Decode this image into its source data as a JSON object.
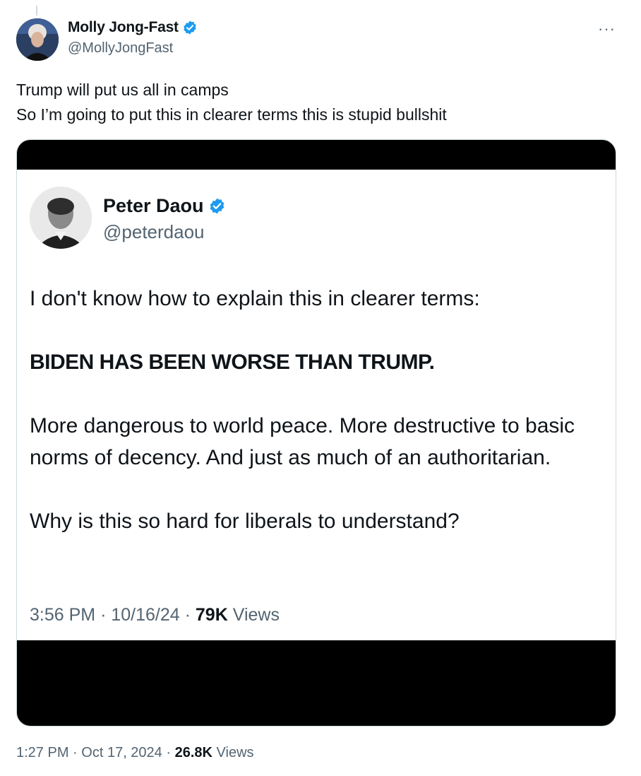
{
  "tweet": {
    "author": {
      "name": "Molly Jong-Fast",
      "handle": "@MollyJongFast",
      "verified": true
    },
    "text_lines": [
      "Trump will put us all in camps",
      "So I’m going to put this in clearer terms this is stupid bullshit"
    ],
    "more_label": "···",
    "meta": {
      "time": "1:27 PM",
      "sep1": "·",
      "date": "Oct 17, 2024",
      "sep2": "·",
      "views_count": "26.8K",
      "views_label": "Views"
    }
  },
  "quoted_screenshot": {
    "author": {
      "name": "Peter Daou",
      "handle": "@peterdaou",
      "verified": true
    },
    "paragraphs": [
      "I don't know how to explain this in clearer terms:",
      "BIDEN HAS BEEN WORSE THAN TRUMP.",
      "More dangerous to world peace. More destructive to basic norms of decency. And just as much of an authoritarian.",
      "Why is this so hard for liberals to understand?"
    ],
    "meta": {
      "time": "3:56 PM",
      "sep1": "·",
      "date": "10/16/24",
      "sep2": "·",
      "views_count": "79K",
      "views_label": "Views"
    }
  },
  "colors": {
    "verified_blue": "#1d9bf0",
    "secondary_text": "#536471",
    "primary_text": "#0f1419"
  },
  "icons": [
    "verified-badge-icon",
    "more-options-icon"
  ]
}
